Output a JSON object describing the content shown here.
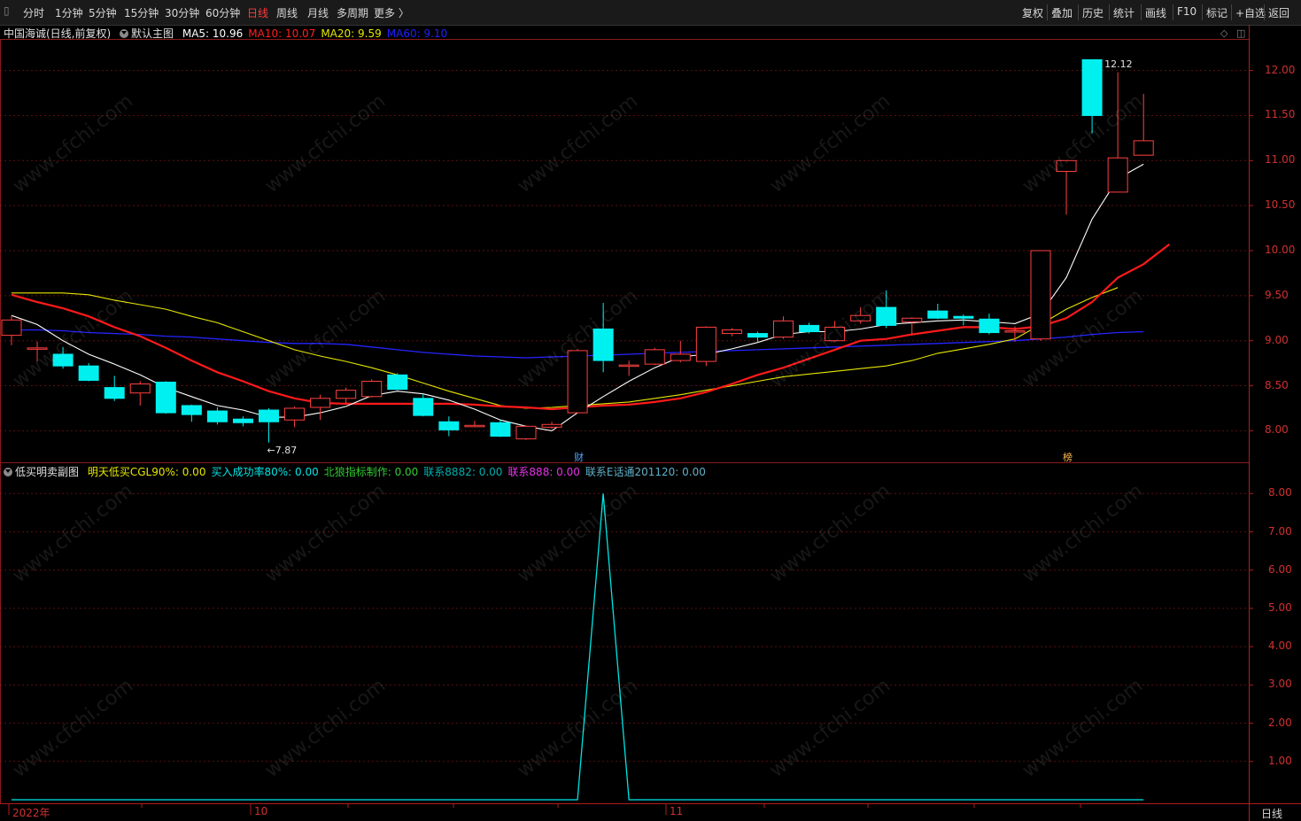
{
  "toolbar": {
    "left_items": [
      {
        "label": "分时",
        "active": false
      },
      {
        "label": "1分钟",
        "active": false
      },
      {
        "label": "5分钟",
        "active": false
      },
      {
        "label": "15分钟",
        "active": false
      },
      {
        "label": "30分钟",
        "active": false
      },
      {
        "label": "60分钟",
        "active": false
      },
      {
        "label": "日线",
        "active": true
      },
      {
        "label": "周线",
        "active": false
      },
      {
        "label": "月线",
        "active": false
      },
      {
        "label": "多周期",
        "active": false
      },
      {
        "label": "更多 〉",
        "active": false
      }
    ],
    "right_items": [
      "复权",
      "叠加",
      "历史",
      "统计",
      "画线",
      "F10",
      "标记",
      "+自选",
      "返回"
    ]
  },
  "main_chart": {
    "stock_title": "中国海诚(日线,前复权)",
    "template_label": "默认主图",
    "ma": [
      {
        "label": "MA5: 10.96",
        "color": "#ffffff"
      },
      {
        "label": "MA10: 10.07",
        "color": "#ff2020"
      },
      {
        "label": "MA20: 9.59",
        "color": "#e6e600"
      },
      {
        "label": "MA60: 9.10",
        "color": "#2020ff"
      }
    ],
    "y_ticks": [
      "12.00",
      "11.50",
      "11.00",
      "10.50",
      "10.00",
      "9.50",
      "9.00",
      "8.50",
      "8.00"
    ],
    "y_tick_values": [
      12.0,
      11.5,
      11.0,
      10.5,
      10.0,
      9.5,
      9.0,
      8.5,
      8.0
    ],
    "high_mark": "12.12",
    "low_mark": "←7.87",
    "event_markers": [
      {
        "label": "财",
        "color": "#4da6ff"
      },
      {
        "label": "榜",
        "color": "#ffb84d"
      }
    ]
  },
  "sub_chart": {
    "title": "低买明卖副图",
    "indicators": [
      {
        "label": "明天低买CGL90%: 0.00",
        "color": "#e6e600"
      },
      {
        "label": "买入成功率80%: 0.00",
        "color": "#00e5e5"
      },
      {
        "label": "北狼指标制作: 0.00",
        "color": "#33cc33"
      },
      {
        "label": "联系8882: 0.00",
        "color": "#00b0b0"
      },
      {
        "label": "联系888: 0.00",
        "color": "#e633e6"
      },
      {
        "label": "联系E话通201120: 0.00",
        "color": "#5fb0c8"
      }
    ],
    "y_ticks": [
      "8.00",
      "7.00",
      "6.00",
      "5.00",
      "4.00",
      "3.00",
      "2.00",
      "1.00"
    ],
    "y_tick_values": [
      8,
      7,
      6,
      5,
      4,
      3,
      2,
      1
    ]
  },
  "date_axis": {
    "labels": [
      "2022年",
      "10",
      "11"
    ]
  },
  "period_label": "日线",
  "watermark": "www.cfchi.com",
  "chart_data": {
    "type": "candlestick",
    "candles": [
      {
        "o": 9.06,
        "c": 9.23,
        "h": 9.28,
        "l": 8.95
      },
      {
        "o": 8.92,
        "c": 8.92,
        "h": 8.99,
        "l": 8.77
      },
      {
        "o": 8.85,
        "c": 8.72,
        "h": 8.93,
        "l": 8.69
      },
      {
        "o": 8.72,
        "c": 8.56,
        "h": 8.75,
        "l": 8.55
      },
      {
        "o": 8.48,
        "c": 8.36,
        "h": 8.61,
        "l": 8.33
      },
      {
        "o": 8.42,
        "c": 8.52,
        "h": 8.55,
        "l": 8.28
      },
      {
        "o": 8.54,
        "c": 8.2,
        "h": 8.55,
        "l": 8.19
      },
      {
        "o": 8.28,
        "c": 8.18,
        "h": 8.29,
        "l": 8.1
      },
      {
        "o": 8.22,
        "c": 8.1,
        "h": 8.26,
        "l": 8.07
      },
      {
        "o": 8.13,
        "c": 8.09,
        "h": 8.16,
        "l": 8.05
      },
      {
        "o": 8.23,
        "c": 8.1,
        "h": 8.25,
        "l": 7.87
      },
      {
        "o": 8.12,
        "c": 8.25,
        "h": 8.27,
        "l": 8.04
      },
      {
        "o": 8.26,
        "c": 8.36,
        "h": 8.4,
        "l": 8.12
      },
      {
        "o": 8.36,
        "c": 8.45,
        "h": 8.48,
        "l": 8.3
      },
      {
        "o": 8.38,
        "c": 8.55,
        "h": 8.57,
        "l": 8.37
      },
      {
        "o": 8.62,
        "c": 8.46,
        "h": 8.64,
        "l": 8.45
      },
      {
        "o": 8.36,
        "c": 8.17,
        "h": 8.41,
        "l": 8.16
      },
      {
        "o": 8.1,
        "c": 8.01,
        "h": 8.16,
        "l": 7.94
      },
      {
        "o": 8.05,
        "c": 8.06,
        "h": 8.11,
        "l": 8.04
      },
      {
        "o": 8.09,
        "c": 7.94,
        "h": 8.12,
        "l": 7.93
      },
      {
        "o": 7.91,
        "c": 8.05,
        "h": 8.06,
        "l": 7.9
      },
      {
        "o": 8.04,
        "c": 8.07,
        "h": 8.1,
        "l": 8.02
      },
      {
        "o": 8.2,
        "c": 8.89,
        "h": 8.91,
        "l": 8.2
      },
      {
        "o": 9.13,
        "c": 8.78,
        "h": 9.42,
        "l": 8.65
      },
      {
        "o": 8.72,
        "c": 8.73,
        "h": 8.78,
        "l": 8.61
      },
      {
        "o": 8.74,
        "c": 8.9,
        "h": 8.92,
        "l": 8.73
      },
      {
        "o": 8.78,
        "c": 8.85,
        "h": 9.0,
        "l": 8.76
      },
      {
        "o": 8.77,
        "c": 9.15,
        "h": 9.16,
        "l": 8.72
      },
      {
        "o": 9.08,
        "c": 9.12,
        "h": 9.14,
        "l": 9.05
      },
      {
        "o": 9.08,
        "c": 9.04,
        "h": 9.1,
        "l": 8.98
      },
      {
        "o": 9.04,
        "c": 9.22,
        "h": 9.27,
        "l": 9.02
      },
      {
        "o": 9.17,
        "c": 9.1,
        "h": 9.2,
        "l": 9.08
      },
      {
        "o": 9.0,
        "c": 9.15,
        "h": 9.22,
        "l": 8.99
      },
      {
        "o": 9.22,
        "c": 9.28,
        "h": 9.37,
        "l": 9.19
      },
      {
        "o": 9.37,
        "c": 9.17,
        "h": 9.56,
        "l": 9.14
      },
      {
        "o": 9.21,
        "c": 9.25,
        "h": 9.26,
        "l": 9.06
      },
      {
        "o": 9.33,
        "c": 9.25,
        "h": 9.41,
        "l": 9.24
      },
      {
        "o": 9.27,
        "c": 9.25,
        "h": 9.29,
        "l": 9.17
      },
      {
        "o": 9.24,
        "c": 9.09,
        "h": 9.3,
        "l": 9.07
      },
      {
        "o": 9.1,
        "c": 9.11,
        "h": 9.16,
        "l": 8.99
      },
      {
        "o": 9.02,
        "c": 10.0,
        "h": 10.0,
        "l": 9.0
      },
      {
        "o": 10.88,
        "c": 11.0,
        "h": 11.0,
        "l": 10.4
      },
      {
        "o": 12.12,
        "c": 11.5,
        "h": 12.12,
        "l": 11.3
      },
      {
        "o": 10.65,
        "c": 11.03,
        "h": 11.98,
        "l": 10.65
      },
      {
        "o": 11.06,
        "c": 11.22,
        "h": 11.74,
        "l": 11.06
      }
    ],
    "ma5": [
      9.28,
      9.18,
      9.0,
      8.85,
      8.74,
      8.62,
      8.48,
      8.38,
      8.28,
      8.23,
      8.15,
      8.15,
      8.2,
      8.27,
      8.39,
      8.44,
      8.41,
      8.34,
      8.24,
      8.12,
      8.05,
      8.0,
      8.2,
      8.38,
      8.55,
      8.7,
      8.82,
      8.85,
      8.91,
      8.98,
      9.07,
      9.1,
      9.1,
      9.13,
      9.18,
      9.2,
      9.22,
      9.23,
      9.21,
      9.19,
      9.3,
      9.7,
      10.35,
      10.8,
      10.96
    ],
    "ma10": [
      9.51,
      9.43,
      9.36,
      9.27,
      9.15,
      9.05,
      8.92,
      8.78,
      8.65,
      8.55,
      8.44,
      8.36,
      8.31,
      8.3,
      8.3,
      8.3,
      8.3,
      8.3,
      8.29,
      8.27,
      8.26,
      8.24,
      8.26,
      8.28,
      8.29,
      8.32,
      8.36,
      8.43,
      8.52,
      8.62,
      8.7,
      8.8,
      8.9,
      9.0,
      9.02,
      9.07,
      9.11,
      9.15,
      9.15,
      9.13,
      9.16,
      9.25,
      9.43,
      9.7,
      9.85,
      10.07
    ],
    "ma20": [
      9.53,
      9.53,
      9.53,
      9.51,
      9.45,
      9.4,
      9.35,
      9.27,
      9.2,
      9.1,
      9.0,
      8.9,
      8.83,
      8.77,
      8.7,
      8.62,
      8.53,
      8.44,
      8.36,
      8.28,
      8.25,
      8.26,
      8.28,
      8.3,
      8.32,
      8.36,
      8.4,
      8.45,
      8.5,
      8.55,
      8.6,
      8.63,
      8.66,
      8.69,
      8.72,
      8.78,
      8.86,
      8.91,
      8.96,
      9.02,
      9.18,
      9.35,
      9.48,
      9.59
    ],
    "ma60": [
      9.12,
      9.12,
      9.11,
      9.09,
      9.08,
      9.07,
      9.05,
      9.04,
      9.02,
      9.0,
      8.98,
      8.97,
      8.97,
      8.96,
      8.93,
      8.9,
      8.87,
      8.85,
      8.83,
      8.82,
      8.81,
      8.82,
      8.83,
      8.84,
      8.85,
      8.86,
      8.87,
      8.88,
      8.89,
      8.9,
      8.91,
      8.92,
      8.93,
      8.94,
      8.95,
      8.96,
      8.97,
      8.98,
      8.99,
      9.0,
      9.02,
      9.04,
      9.07,
      9.09,
      9.1
    ],
    "signal": [
      0,
      0,
      0,
      0,
      0,
      0,
      0,
      0,
      0,
      0,
      0,
      0,
      0,
      0,
      0,
      0,
      0,
      0,
      0,
      0,
      0,
      0,
      0,
      8,
      0,
      0,
      0,
      0,
      0,
      0,
      0,
      0,
      0,
      0,
      0,
      0,
      0,
      0,
      0,
      0,
      0,
      0,
      0,
      0,
      0
    ],
    "main_ylim": [
      7.65,
      12.35
    ],
    "sub_ylim": [
      0,
      8.4
    ],
    "up_color": "#ff4040",
    "down_color": "#00f0f0",
    "signal_color": "#00e5e5",
    "grid": "dashed red horizontal"
  }
}
